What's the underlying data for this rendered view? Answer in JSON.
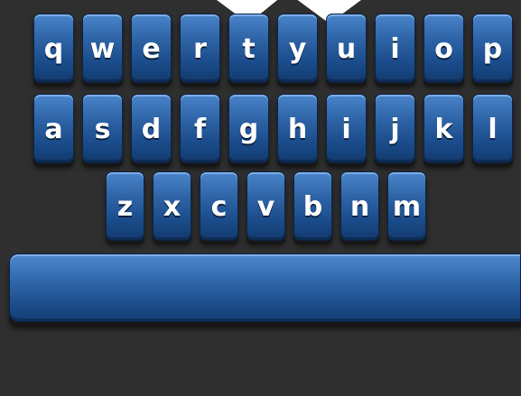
{
  "keyboard": {
    "rows": [
      [
        "q",
        "w",
        "e",
        "r",
        "t",
        "y",
        "u",
        "i",
        "o",
        "p"
      ],
      [
        "a",
        "s",
        "d",
        "f",
        "g",
        "h",
        "i",
        "j",
        "k",
        "l"
      ],
      [
        "z",
        "x",
        "c",
        "v",
        "b",
        "n",
        "m"
      ]
    ],
    "space_label": "",
    "colors": {
      "background": "#2f2f2f",
      "key_top": "#4a84c9",
      "key_bottom": "#123a6d",
      "key_text": "#ffffff"
    }
  }
}
